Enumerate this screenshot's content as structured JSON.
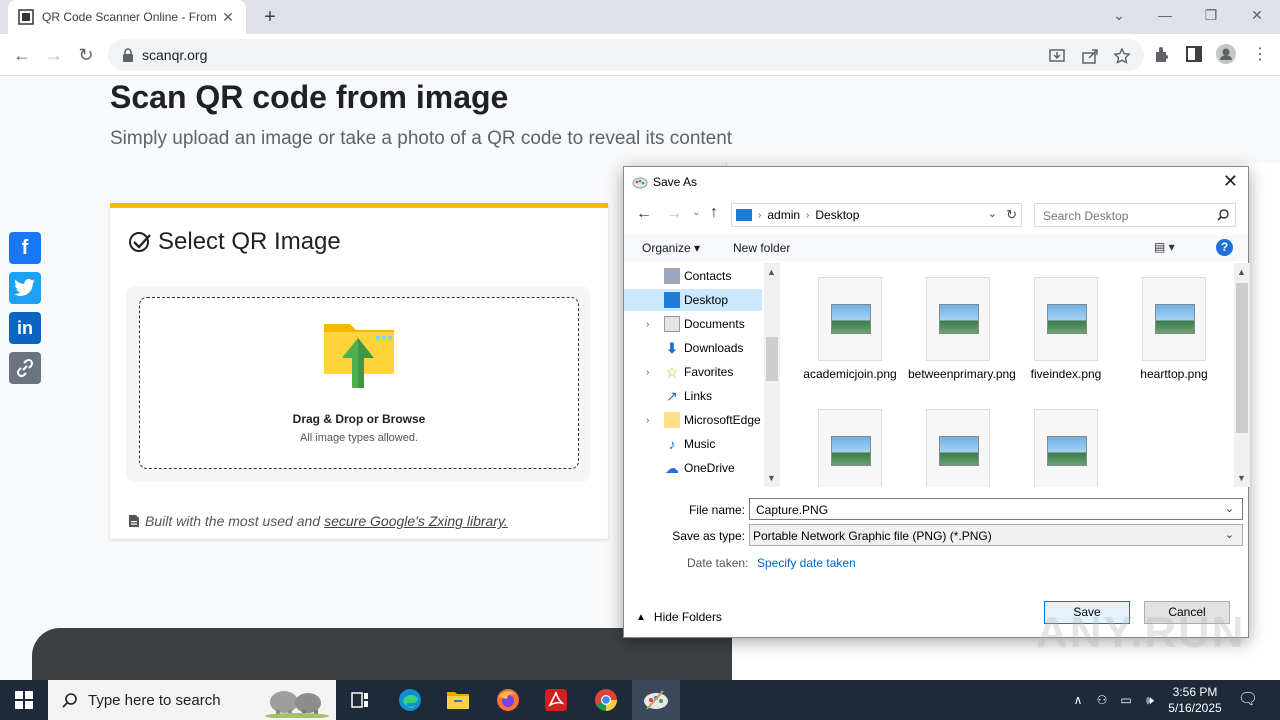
{
  "browser": {
    "tab_title": "QR Code Scanner Online - From",
    "url": "scanqr.org"
  },
  "page": {
    "heading": "Scan QR code from image",
    "subheading": "Simply upload an image or take a photo of a QR code to reveal its content",
    "card_title": "Select QR Image",
    "drop_label": "Drag & Drop or Browse",
    "drop_hint": "All image types allowed.",
    "built_text": "Built with the most used and",
    "built_link": "secure Google's Zxing library.",
    "accent_color": "#fbbc04"
  },
  "social": [
    "facebook-icon",
    "twitter-icon",
    "linkedin-icon",
    "copy-link-icon"
  ],
  "dialog": {
    "title": "Save As",
    "path": [
      "admin",
      "Desktop"
    ],
    "search_placeholder": "Search Desktop",
    "organize": "Organize",
    "new_folder": "New folder",
    "nav_items": [
      {
        "label": "Contacts",
        "expandable": false,
        "selected": false,
        "icon": "contacts-icon"
      },
      {
        "label": "Desktop",
        "expandable": false,
        "selected": true,
        "icon": "desktop-icon"
      },
      {
        "label": "Documents",
        "expandable": true,
        "selected": false,
        "icon": "documents-icon"
      },
      {
        "label": "Downloads",
        "expandable": false,
        "selected": false,
        "icon": "downloads-icon"
      },
      {
        "label": "Favorites",
        "expandable": true,
        "selected": false,
        "icon": "favorites-icon"
      },
      {
        "label": "Links",
        "expandable": false,
        "selected": false,
        "icon": "links-icon"
      },
      {
        "label": "MicrosoftEdge",
        "expandable": true,
        "selected": false,
        "icon": "folder-icon"
      },
      {
        "label": "Music",
        "expandable": false,
        "selected": false,
        "icon": "music-icon"
      },
      {
        "label": "OneDrive",
        "expandable": false,
        "selected": false,
        "icon": "onedrive-icon"
      }
    ],
    "files": [
      {
        "name": "academicjoin.png"
      },
      {
        "name": "betweenprimary.png"
      },
      {
        "name": "fiveindex.png"
      },
      {
        "name": "hearttop.png"
      },
      {
        "name": ""
      },
      {
        "name": ""
      },
      {
        "name": ""
      }
    ],
    "file_name_label": "File name:",
    "file_name_value": "Capture.PNG",
    "save_type_label": "Save as type:",
    "save_type_value": "Portable Network Graphic file (PNG) (*.PNG)",
    "date_label": "Date taken:",
    "date_link": "Specify date taken",
    "hide_folders": "Hide Folders",
    "save": "Save",
    "cancel": "Cancel"
  },
  "taskbar": {
    "search_placeholder": "Type here to search",
    "time": "3:56 PM",
    "date": "5/16/2025"
  },
  "watermark": "ANY.RUN"
}
